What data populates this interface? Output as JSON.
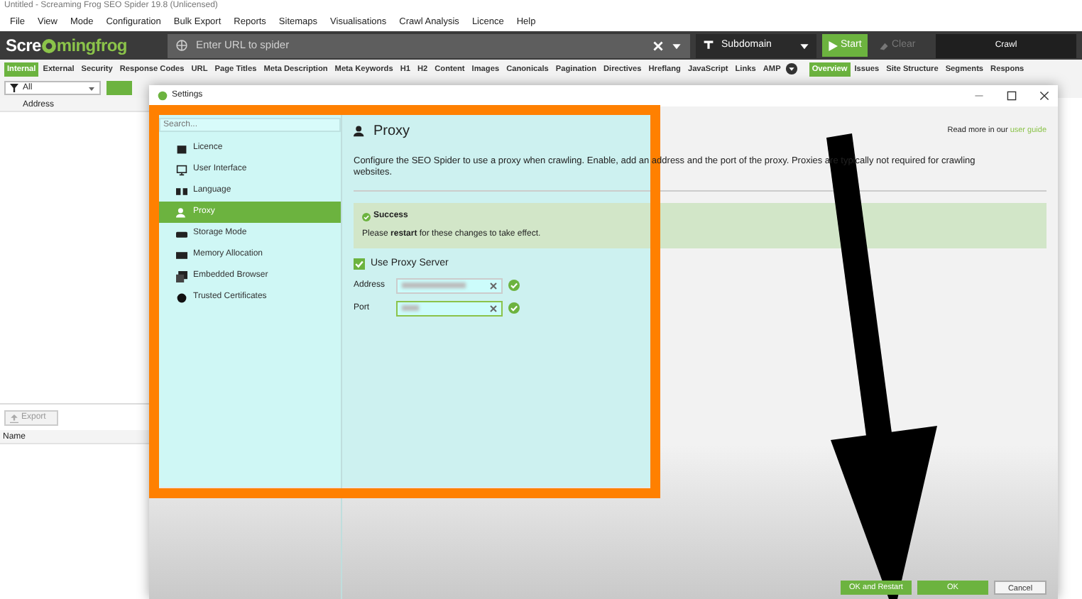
{
  "window": {
    "title": "Untitled - Screaming Frog SEO Spider 19.8 (Unlicensed)"
  },
  "menu": [
    "File",
    "View",
    "Mode",
    "Configuration",
    "Bulk Export",
    "Reports",
    "Sitemaps",
    "Visualisations",
    "Crawl Analysis",
    "Licence",
    "Help"
  ],
  "toolbar": {
    "logo_start": "Scre",
    "logo_end": "mingfrog",
    "url_placeholder": "Enter URL to spider",
    "mode": "Subdomain",
    "start": "Start",
    "clear": "Clear",
    "crawl": {
      "label": "Crawl",
      "level": 0
    }
  },
  "tabs": [
    {
      "label": "Internal",
      "selected": true
    },
    {
      "label": "External",
      "selected": false
    },
    {
      "label": "Security",
      "selected": false
    },
    {
      "label": "Response Codes",
      "selected": false
    },
    {
      "label": "URL",
      "selected": false
    },
    {
      "label": "Page Titles",
      "selected": false
    },
    {
      "label": "Meta Description",
      "selected": false
    },
    {
      "label": "Meta Keywords",
      "selected": false
    },
    {
      "label": "H1",
      "selected": false
    },
    {
      "label": "H2",
      "selected": false
    },
    {
      "label": "Content",
      "selected": false
    },
    {
      "label": "Images",
      "selected": false
    },
    {
      "label": "Canonicals",
      "selected": false
    },
    {
      "label": "Pagination",
      "selected": false
    },
    {
      "label": "Directives",
      "selected": false
    },
    {
      "label": "Hreflang",
      "selected": false
    },
    {
      "label": "JavaScript",
      "selected": false
    },
    {
      "label": "Links",
      "selected": false
    },
    {
      "label": "AMP",
      "selected": false
    }
  ],
  "right_tabs": [
    {
      "label": "Overview",
      "selected": true
    },
    {
      "label": "Issues",
      "selected": false
    },
    {
      "label": "Site Structure",
      "selected": false
    },
    {
      "label": "Segments",
      "selected": false
    },
    {
      "label": "Respons",
      "selected": false
    }
  ],
  "filter": "All",
  "main_table": {
    "columns": [
      "Address"
    ]
  },
  "export": "Export",
  "details_table": {
    "columns": [
      "Name"
    ]
  },
  "dialog": {
    "title": "Settings",
    "search_placeholder": "Search...",
    "nav": [
      {
        "label": "Licence",
        "selected": false
      },
      {
        "label": "User Interface",
        "selected": false
      },
      {
        "label": "Language",
        "selected": false
      },
      {
        "label": "Proxy",
        "selected": true
      },
      {
        "label": "Storage Mode",
        "selected": false
      },
      {
        "label": "Memory Allocation",
        "selected": false
      },
      {
        "label": "Embedded Browser",
        "selected": false
      },
      {
        "label": "Trusted Certificates",
        "selected": false
      }
    ],
    "heading": "Proxy",
    "help_text": "Read more in our",
    "help_link": "user guide",
    "description": "Configure the SEO Spider to use a proxy when crawling. Enable, add an address and the port of the proxy. Proxies are typically not required for crawling websites.",
    "alert": {
      "title": "Success",
      "message": "Please **restart** for these changes to take effect."
    },
    "use_proxy": {
      "label": "Use Proxy Server",
      "checked": true
    },
    "fields": [
      {
        "label": "Address"
      },
      {
        "label": "Port"
      }
    ],
    "buttons": [
      {
        "label": "OK and Restart",
        "kind": "primary"
      },
      {
        "label": "OK",
        "kind": "primary"
      },
      {
        "label": "Cancel",
        "kind": "secondary"
      }
    ]
  }
}
